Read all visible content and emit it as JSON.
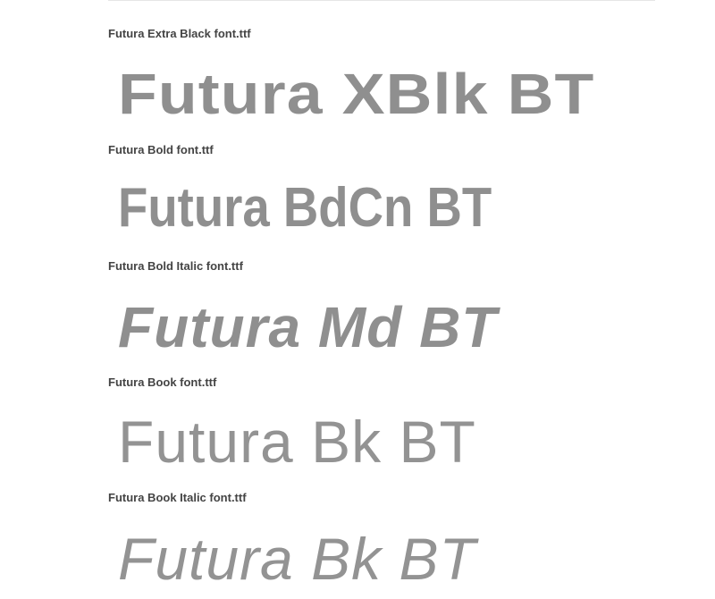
{
  "fonts": [
    {
      "label": "Futura Extra Black font.ttf",
      "sample": "Futura XBlk BT"
    },
    {
      "label": "Futura Bold font.ttf",
      "sample": "Futura BdCn BT"
    },
    {
      "label": "Futura Bold Italic font.ttf",
      "sample": "Futura Md BT"
    },
    {
      "label": "Futura Book font.ttf",
      "sample": "Futura Bk BT"
    },
    {
      "label": "Futura Book Italic font.ttf",
      "sample": "Futura Bk BT"
    }
  ],
  "colors": {
    "label_text": "#444444",
    "sample_text": "#8f8f8f",
    "background": "#ffffff"
  }
}
